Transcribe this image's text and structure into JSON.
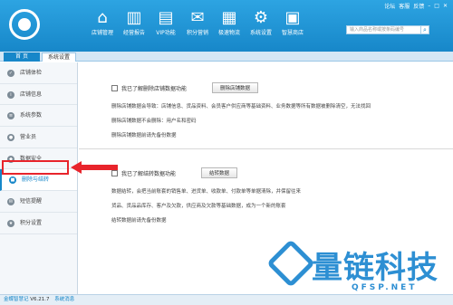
{
  "header": {
    "nav": [
      {
        "label": "店铺管理",
        "icon": "shop-icon"
      },
      {
        "label": "经营报告",
        "icon": "report-icon"
      },
      {
        "label": "VIP功能",
        "icon": "vip-icon"
      },
      {
        "label": "积分营销",
        "icon": "marketing-icon"
      },
      {
        "label": "极速物流",
        "icon": "logistics-icon"
      },
      {
        "label": "系统设置",
        "icon": "settings-icon"
      },
      {
        "label": "智慧商店",
        "icon": "store-icon"
      }
    ],
    "window_controls": {
      "forum": "论坛",
      "help": "客服",
      "feedback": "反馈"
    },
    "search": {
      "placeholder": "输入商品名称或按条码编号"
    }
  },
  "tabs": {
    "home": "首 页",
    "settings": "系统设置"
  },
  "sidebar": {
    "items": [
      {
        "label": "店铺体检",
        "icon": "check-icon"
      },
      {
        "label": "店铺信息",
        "icon": "info-icon"
      },
      {
        "label": "系统参数",
        "icon": "params-icon"
      },
      {
        "label": "营业员",
        "icon": "staff-icon"
      },
      {
        "label": "数据安全",
        "icon": "security-icon"
      },
      {
        "label": "删除与结转",
        "icon": "delete-icon"
      },
      {
        "label": "短信提醒",
        "icon": "sms-icon"
      },
      {
        "label": "积分设置",
        "icon": "points-icon"
      }
    ],
    "active_index": 5
  },
  "main": {
    "delete_section": {
      "checkbox_label": "我已了解删除店铺数据功能",
      "button_label": "删除店铺数据",
      "lines": [
        "删除店铺数据会导致：店铺信息、货品资料、会员客户供应商等基础资料、业务数据等所有数据被删除清空，无法找回",
        "删除店铺数据不会删除：用户名和密码",
        "删除店铺数据前请先备份数据"
      ]
    },
    "transfer_section": {
      "checkbox_label": "我已了解结转数据功能",
      "button_label": "结转数据",
      "lines": [
        "数据结转，会把当前账套的销售单、进货单、收款单、付款单等单据清除，并保留往来",
        "货品、货品品库存、客户及欠款，供应商及欠款等基础数据，成为一个新的账套",
        "结转数据前请先备份数据"
      ]
    }
  },
  "statusbar": {
    "app": "金蝶智慧记",
    "version": "V6.21.7",
    "news": "系统消息"
  },
  "watermark": {
    "text": "量链科技",
    "url": "QFSP.NET"
  },
  "colors": {
    "primary": "#1787c9",
    "highlight": "#e8242b"
  }
}
